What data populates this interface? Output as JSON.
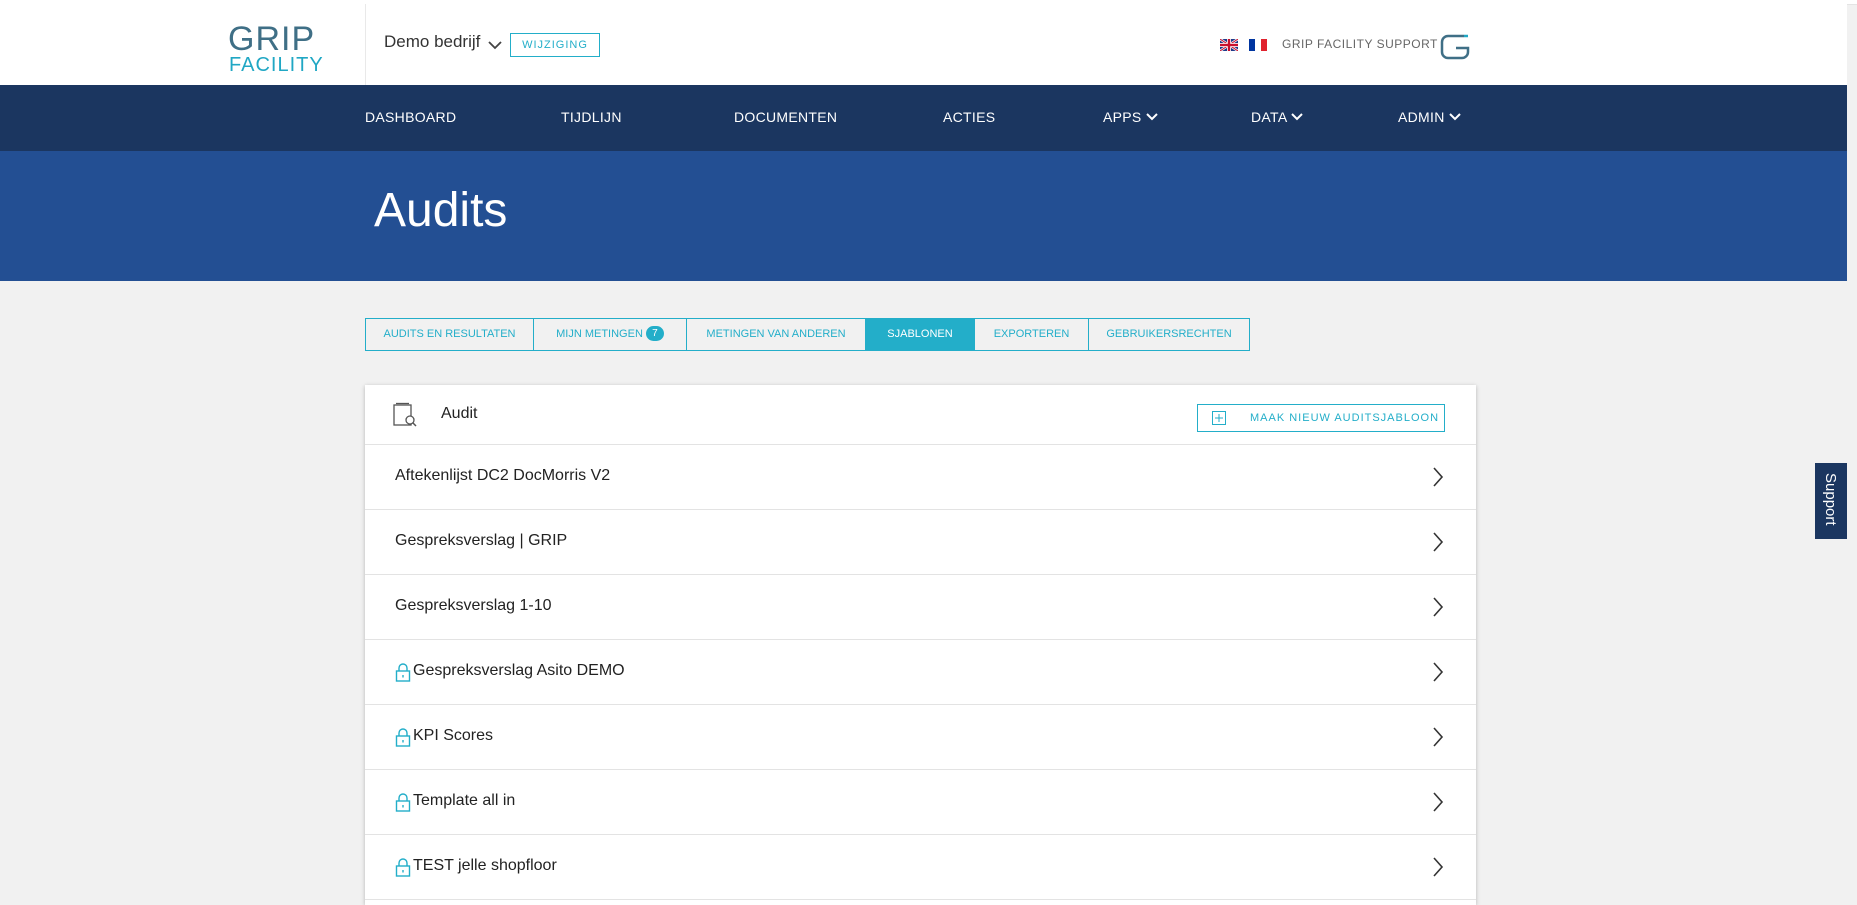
{
  "header": {
    "logo_top": "GRIP",
    "logo_bottom": "FACILITY",
    "company_name": "Demo bedrijf",
    "change_label": "WIJZIGING",
    "support_label": "GRIP FACILITY SUPPORT"
  },
  "nav": {
    "items": [
      {
        "label": "DASHBOARD"
      },
      {
        "label": "TIJDLIJN"
      },
      {
        "label": "DOCUMENTEN"
      },
      {
        "label": "ACTIES"
      },
      {
        "label": "APPS"
      },
      {
        "label": "DATA"
      },
      {
        "label": "ADMIN"
      }
    ]
  },
  "page": {
    "title": "Audits"
  },
  "tabs": [
    {
      "label": "AUDITS EN RESULTATEN"
    },
    {
      "label": "MIJN METINGEN",
      "badge": "7"
    },
    {
      "label": "METINGEN VAN ANDEREN"
    },
    {
      "label": "SJABLONEN",
      "active": true
    },
    {
      "label": "EXPORTEREN"
    },
    {
      "label": "GEBRUIKERSRECHTEN"
    }
  ],
  "card": {
    "title": "Audit",
    "new_button": "MAAK NIEUW AUDITSJABLOON",
    "templates": [
      {
        "name": "Aftekenlijst DC2 DocMorris V2",
        "locked": false
      },
      {
        "name": "Gespreksverslag | GRIP",
        "locked": false
      },
      {
        "name": "Gespreksverslag 1-10",
        "locked": false
      },
      {
        "name": "Gespreksverslag Asito DEMO",
        "locked": true
      },
      {
        "name": "KPI Scores",
        "locked": true
      },
      {
        "name": "Template all in",
        "locked": true
      },
      {
        "name": "TEST jelle shopfloor",
        "locked": true
      }
    ]
  },
  "support_tab": "Support",
  "colors": {
    "nav_bg": "#1b3660",
    "banner_bg": "#234f93",
    "accent": "#23aec9"
  }
}
